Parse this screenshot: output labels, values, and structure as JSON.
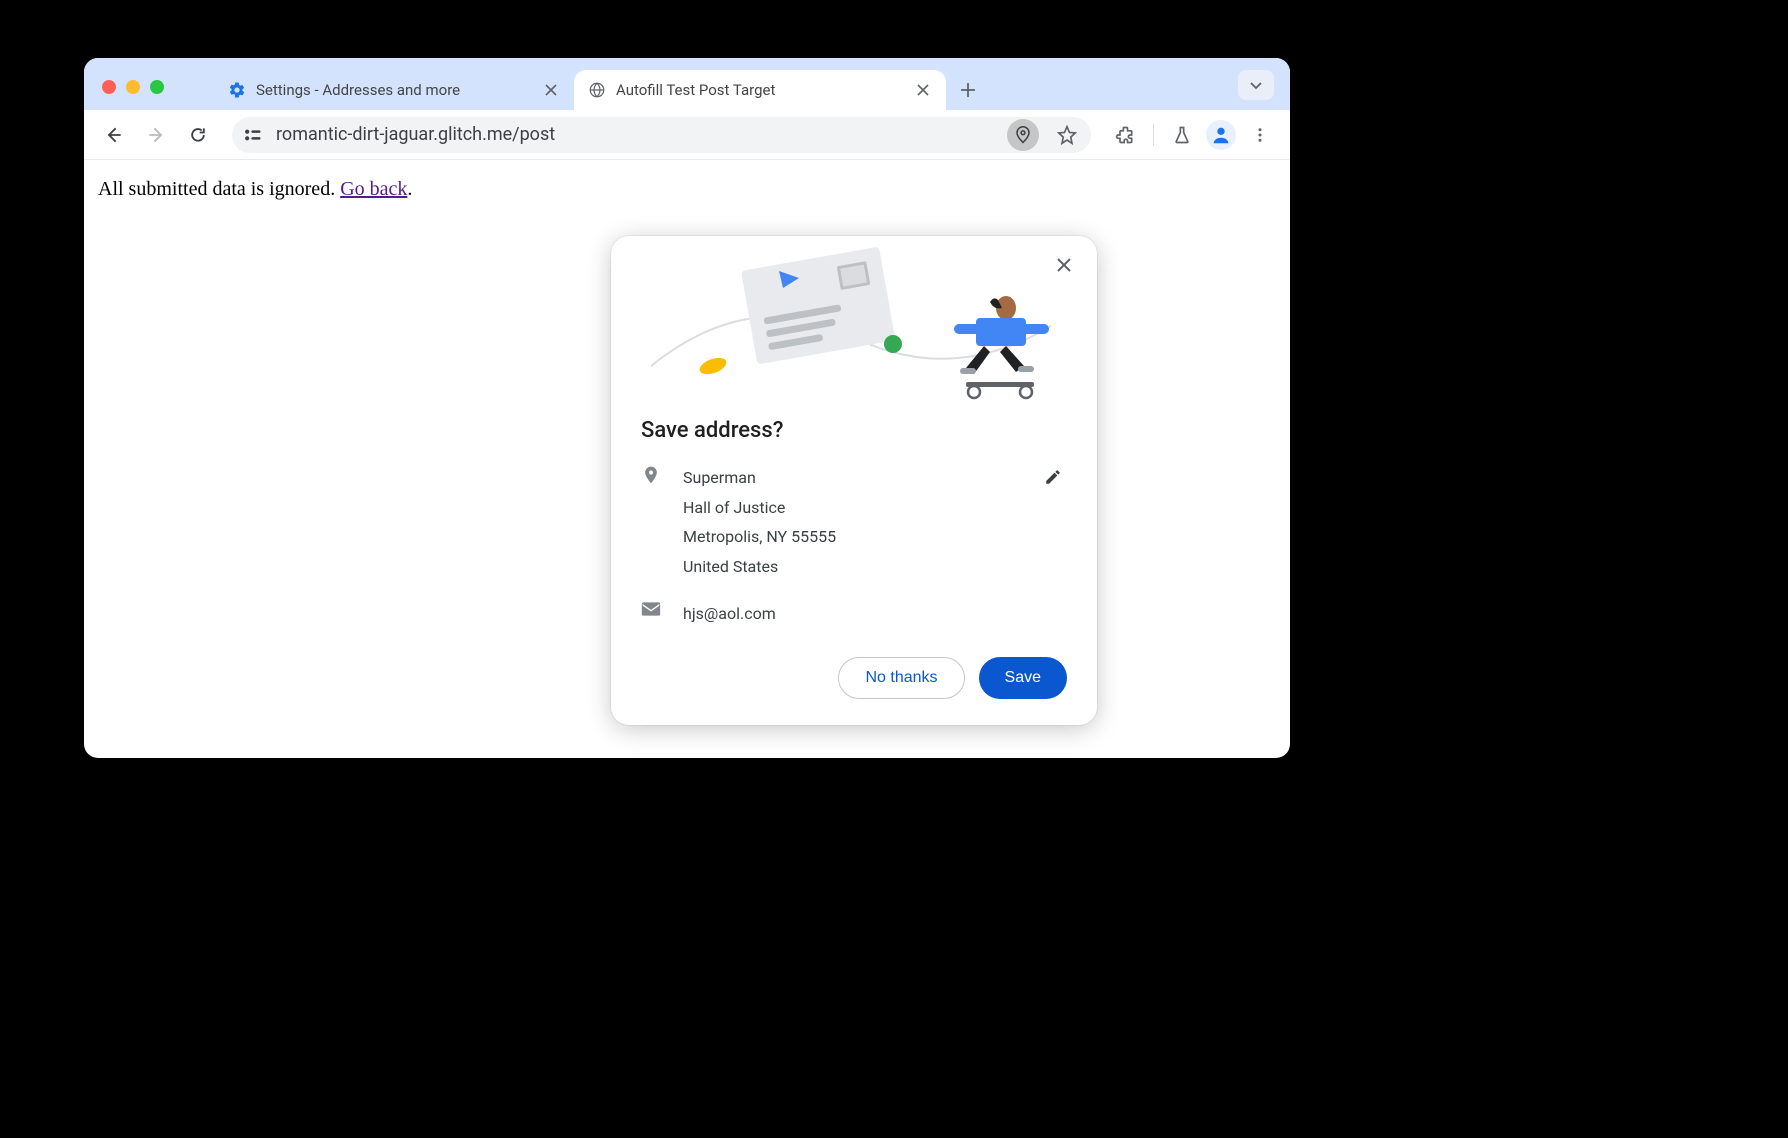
{
  "tabs": [
    {
      "title": "Settings - Addresses and more",
      "icon": "gear"
    },
    {
      "title": "Autofill Test Post Target",
      "icon": "globe"
    }
  ],
  "url": "romantic-dirt-jaguar.glitch.me/post",
  "page": {
    "text": "All submitted data is ignored. ",
    "link_text": "Go back",
    "period": "."
  },
  "popup": {
    "title": "Save address?",
    "address": {
      "name": "Superman",
      "line1": "Hall of Justice",
      "line2": "Metropolis, NY 55555",
      "country": "United States"
    },
    "email": "hjs@aol.com",
    "buttons": {
      "secondary": "No thanks",
      "primary": "Save"
    }
  }
}
